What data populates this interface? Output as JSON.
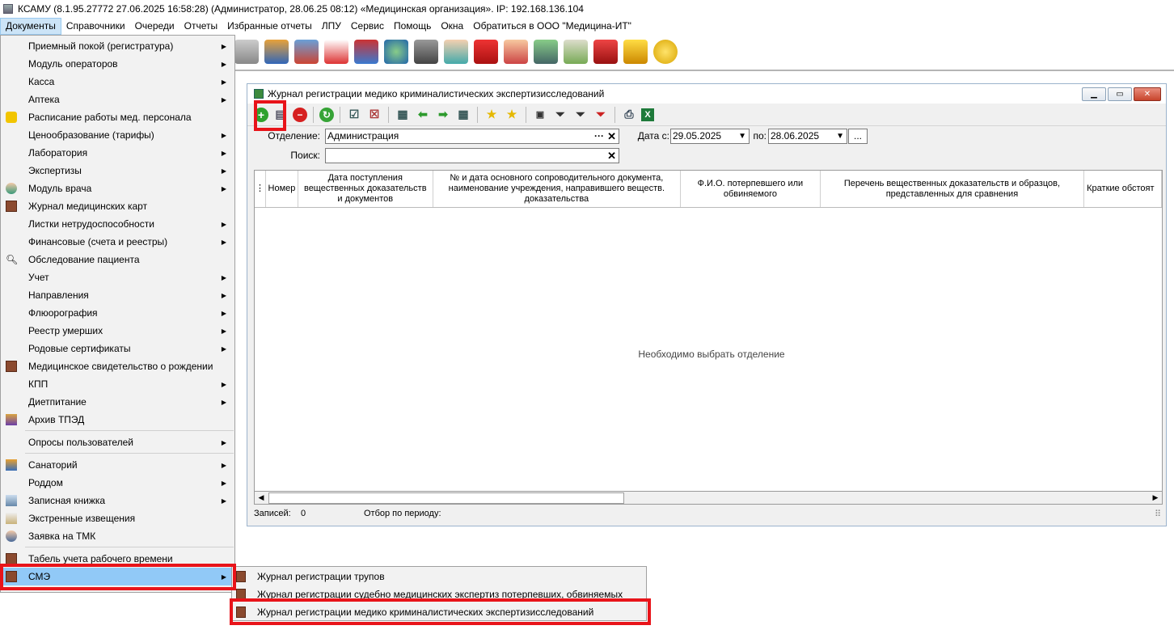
{
  "window_title": "КСАМУ (8.1.95.27772 27.06.2025 16:58:28) (Администратор, 28.06.25 08:12)  «Медицинская организация». IP: 192.168.136.104",
  "menubar": [
    "Документы",
    "Справочники",
    "Очереди",
    "Отчеты",
    "Избранные отчеты",
    "ЛПУ",
    "Сервис",
    "Помощь",
    "Окна",
    "Обратиться в ООО \"Медицина-ИТ\""
  ],
  "menu_items": [
    {
      "label": "Приемный покой (регистратура)",
      "arrow": "▶",
      "icon": ""
    },
    {
      "label": "Модуль операторов",
      "arrow": "▶",
      "icon": ""
    },
    {
      "label": "Касса",
      "arrow": "▶",
      "icon": ""
    },
    {
      "label": "Аптека",
      "arrow": "▶",
      "icon": ""
    },
    {
      "label": "Расписание работы мед. персонала",
      "arrow": "",
      "icon": "schedule-icon"
    },
    {
      "label": "Ценообразование (тарифы)",
      "arrow": "▶",
      "icon": ""
    },
    {
      "label": "Лаборатория",
      "arrow": "▶",
      "icon": ""
    },
    {
      "label": "Экспертизы",
      "arrow": "▶",
      "icon": ""
    },
    {
      "label": "Модуль врача",
      "arrow": "▶",
      "icon": "doctor-icon"
    },
    {
      "label": "Журнал медицинских карт",
      "arrow": "",
      "icon": "book-icon"
    },
    {
      "label": "Листки нетрудоспособности",
      "arrow": "▶",
      "icon": ""
    },
    {
      "label": "Финансовые (счета и реестры)",
      "arrow": "▶",
      "icon": ""
    },
    {
      "label": "Обследование пациента",
      "arrow": "",
      "icon": "magnifier-icon"
    },
    {
      "label": "Учет",
      "arrow": "▶",
      "icon": ""
    },
    {
      "label": "Направления",
      "arrow": "▶",
      "icon": ""
    },
    {
      "label": "Флюорография",
      "arrow": "▶",
      "icon": ""
    },
    {
      "label": "Реестр умерших",
      "arrow": "▶",
      "icon": ""
    },
    {
      "label": "Родовые сертификаты",
      "arrow": "▶",
      "icon": ""
    },
    {
      "label": "Медицинское свидетельство о рождении",
      "arrow": "",
      "icon": "book-icon"
    },
    {
      "label": "КПП",
      "arrow": "▶",
      "icon": ""
    },
    {
      "label": "Диетпитание",
      "arrow": "▶",
      "icon": ""
    },
    {
      "label": "Архив ТПЭД",
      "arrow": "",
      "icon": "archive-icon"
    },
    {
      "label": "Опросы пользователей",
      "arrow": "▶",
      "icon": ""
    },
    {
      "label": "Санаторий",
      "arrow": "▶",
      "icon": "house-icon"
    },
    {
      "label": "Роддом",
      "arrow": "▶",
      "icon": ""
    },
    {
      "label": "Записная книжка",
      "arrow": "▶",
      "icon": "notebook-icon"
    },
    {
      "label": "Экстренные извещения",
      "arrow": "",
      "icon": "envelope-icon"
    },
    {
      "label": "Заявка на ТМК",
      "arrow": "",
      "icon": "users-icon"
    },
    {
      "label": "Табель учета рабочего времени",
      "arrow": "",
      "icon": "book-icon"
    },
    {
      "label": "СМЭ",
      "arrow": "▶",
      "icon": "book-icon"
    }
  ],
  "submenu_items": [
    "Журнал регистрации трупов",
    "Журнал регистрации судебно медицинских экспертиз потерпевших, обвиняемых",
    "Журнал регистрации медико криминалистических экспертизисследований"
  ],
  "child_window": {
    "title": "Журнал регистрации медико криминалистических экспертизисследований",
    "department_label": "Отделение:",
    "department_value": "Администрация",
    "search_label": "Поиск:",
    "search_value": "",
    "date_from_label": "Дата с:",
    "date_from": "29.05.2025",
    "date_to_label": "по:",
    "date_to": "28.06.2025",
    "columns": [
      "Номер",
      "Дата поступления вещественных доказательств и документов",
      "№ и дата основного сопроводительного документа, наименование учреждения, направившего веществ. доказательства",
      "Ф.И.О. потерпевшего или обвиняемого",
      "Перечень вещественных доказательств и образцов, представленных для сравнения",
      "Краткие обстоят"
    ],
    "empty_message": "Необходимо выбрать отделение",
    "records_label": "Записей:",
    "records_count": "0",
    "period_label": "Отбор по периоду:"
  },
  "colors": {
    "highlight": "#91c9f7",
    "menu_bg": "#f2f2f2",
    "red_annotation": "#e8141a"
  }
}
